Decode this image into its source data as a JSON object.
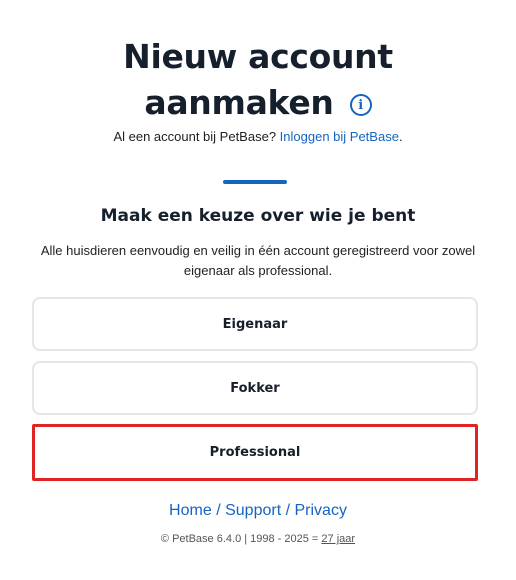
{
  "header": {
    "title_line1": "Nieuw account",
    "title_line2": "aanmaken",
    "info_icon": "info-icon"
  },
  "login_prompt": {
    "text": "Al een account bij PetBase?",
    "link": "Inloggen bij PetBase",
    "suffix": "."
  },
  "colors": {
    "accent": "#1565c0",
    "highlight": "#e02424"
  },
  "choice_section": {
    "heading": "Maak een keuze over wie je bent",
    "description": "Alle huisdieren eenvoudig en veilig in één account geregistreerd voor zowel eigenaar als professional.",
    "options": [
      {
        "label": "Eigenaar"
      },
      {
        "label": "Fokker"
      },
      {
        "label": "Professional"
      }
    ]
  },
  "footer": {
    "links": [
      "Home",
      "Support",
      "Privacy"
    ],
    "separator": "/",
    "copyright": "© PetBase 6.4.0 | 1998 - 2025 =",
    "years_link": "27 jaar"
  }
}
